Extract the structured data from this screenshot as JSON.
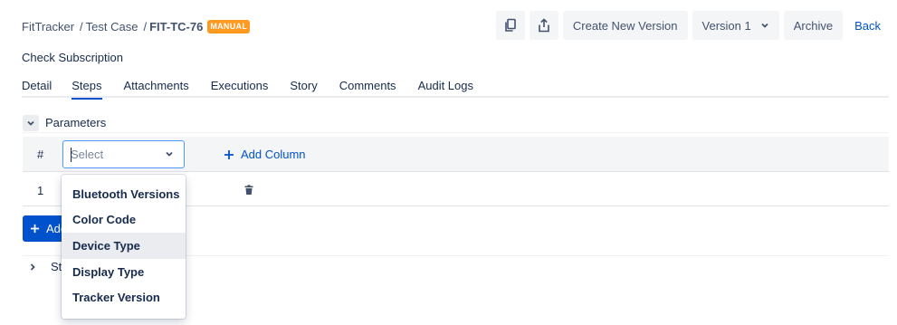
{
  "breadcrumb": {
    "project": "FitTracker",
    "section": "Test Case",
    "issue_key": "FIT-TC-76",
    "badge": "MANUAL",
    "badge_color": "#ff991f"
  },
  "toolbar": {
    "copy_icon": "copy-icon",
    "share_icon": "share-icon",
    "create_version": "Create New Version",
    "version_select": "Version 1",
    "archive": "Archive",
    "back": "Back"
  },
  "title": "Check Subscription",
  "tabs": [
    {
      "label": "Detail",
      "active": false
    },
    {
      "label": "Steps",
      "active": true
    },
    {
      "label": "Attachments",
      "active": false
    },
    {
      "label": "Executions",
      "active": false
    },
    {
      "label": "Story",
      "active": false
    },
    {
      "label": "Comments",
      "active": false
    },
    {
      "label": "Audit Logs",
      "active": false
    }
  ],
  "parameters": {
    "label": "Parameters",
    "column_hash": "#",
    "select_placeholder": "Select",
    "add_column": "Add Column",
    "rows": [
      {
        "num": "1"
      }
    ],
    "add_row_button": "Add"
  },
  "dropdown": {
    "options": [
      "Bluetooth Versions",
      "Color Code",
      "Device Type",
      "Display Type",
      "Tracker Version"
    ],
    "hovered": "Device Type"
  },
  "steps": {
    "label": "Ste"
  },
  "colors": {
    "accent": "#0052cc",
    "focus_border": "#4c9aff",
    "header_bg": "#f4f5f7"
  }
}
